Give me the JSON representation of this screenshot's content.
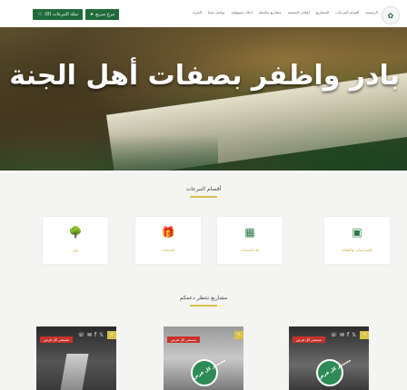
{
  "colors": {
    "brand_green": "#1f6b3a",
    "accent_gold": "#d8c24a",
    "tag_red": "#c8322c"
  },
  "top_actions": [
    {
      "label": "سلة التبرعات (0)",
      "icon": "cart-icon"
    },
    {
      "label": "تبرع سريع",
      "icon": "send-icon"
    }
  ],
  "nav": {
    "items": [
      "الرئيسية",
      "أقسام التبرعات",
      "المشاريع",
      "أوقاف الجمعية",
      "مشاريع مكتملة",
      "إخلاء مسؤولية",
      "تواصل معنا",
      "المزيد"
    ]
  },
  "hero": {
    "title": "بادر واظفر بصفات أهل الجنة",
    "slides": 6,
    "active_slide": 6
  },
  "categories": {
    "title": "أقسام التبرعات",
    "items": [
      {
        "label": "المساعدات والكفالة",
        "icon": "screen-icon"
      },
      {
        "label": "بناء المساجد",
        "icon": "building-icon"
      },
      {
        "label": "الصدقات",
        "icon": "gift-icon"
      },
      {
        "label": "ولي",
        "icon": "tree-icon"
      }
    ]
  },
  "projects": {
    "title": "مشاريع تنتظر دعمكم",
    "cards": [
      {
        "tag": "مستمر كل فرض",
        "badge": ""
      },
      {
        "tag": "مستمر كل فرض",
        "badge": "مستمر كل فرض"
      },
      {
        "tag": "مستمر كل فرض",
        "badge": "مستمر كل فرض"
      }
    ]
  }
}
